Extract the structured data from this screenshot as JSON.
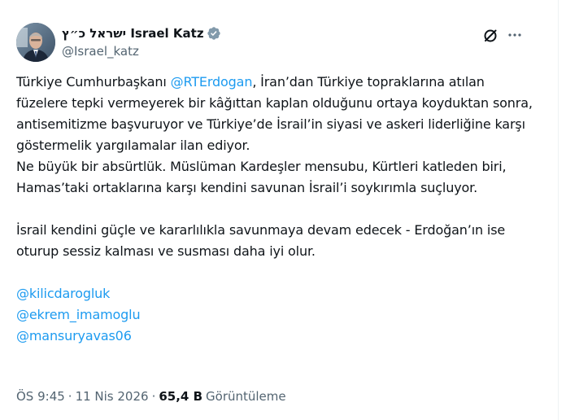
{
  "author": {
    "display_name": "ישראל כ״ץ Israel Katz",
    "handle": "@Israel_katz",
    "verified": true
  },
  "tweet": {
    "line1_a": "Türkiye Cumhurbaşkanı ",
    "mention_erdogan": "@RTErdogan",
    "line1_b": ", İran’dan Türkiye topraklarına atılan füzelere tepki vermeyerek bir kâğıttan kaplan olduğunu ortaya koyduktan sonra, antisemitizme başvuruyor ve Türkiye’de İsrail’in siyasi ve askeri liderliğine karşı göstermelik yargılamalar ilan ediyor.",
    "line2": "Ne büyük bir absürtlük. Müslüman Kardeşler mensubu, Kürtleri katleden biri, Hamas’taki ortaklarına karşı kendini savunan İsrail’i soykırımla suçluyor.",
    "line3": "İsrail kendini güçle ve kararlılıkla savunmaya devam edecek - Erdoğan’ın ise oturup sessiz kalması ve susması daha iyi olur.",
    "mentions": [
      "@kilicdarogluk",
      "@ekrem_imamoglu",
      "@mansuryavas06"
    ]
  },
  "meta": {
    "time": "ÖS 9:45",
    "date": "11 Nis 2026",
    "views_count": "65,4 B",
    "views_label": "Görüntüleme"
  },
  "colors": {
    "link": "#1d9bf0",
    "verified": "#829aab",
    "text": "#0f1419",
    "secondary": "#536471"
  },
  "icons": [
    "grok-icon",
    "more-icon",
    "verified-badge-icon"
  ]
}
